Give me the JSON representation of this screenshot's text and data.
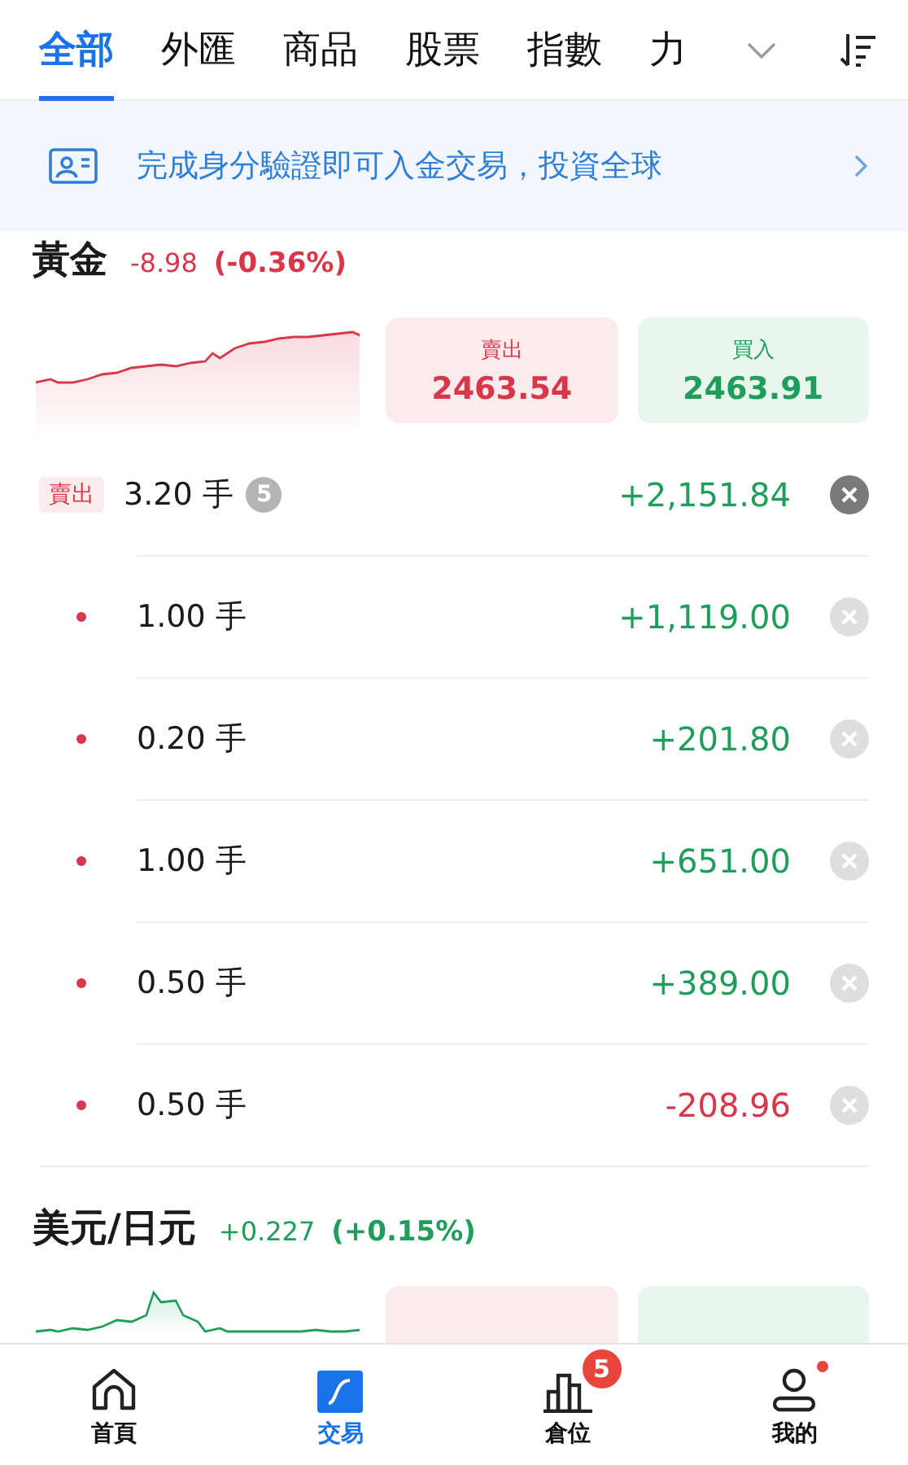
{
  "tabs": [
    {
      "label": "全部",
      "selected": true
    },
    {
      "label": "外匯",
      "selected": false
    },
    {
      "label": "商品",
      "selected": false
    },
    {
      "label": "股票",
      "selected": false
    },
    {
      "label": "指數",
      "selected": false
    },
    {
      "label": "力",
      "selected": false
    }
  ],
  "banner": {
    "text": "完成身分驗證即可入金交易，投資全球"
  },
  "instruments": [
    {
      "name": "黃金",
      "change": "-8.98",
      "change_pct": "(-0.36%)",
      "color": "#d9364a",
      "sell_label": "賣出",
      "sell_price": "2463.54",
      "buy_label": "買入",
      "buy_price": "2463.91",
      "positions": [
        {
          "kind": "group",
          "side": "賣出",
          "lots": "3.20 手",
          "count": "5",
          "pnl": "+2,151.84",
          "color": "#1e9e5a",
          "children": [
            {
              "kind": "item",
              "lots": "1.00 手",
              "pnl": "+1,119.00",
              "color": "#1e9e5a"
            },
            {
              "kind": "item",
              "lots": "0.20 手",
              "pnl": "+201.80",
              "color": "#1e9e5a"
            },
            {
              "kind": "item",
              "lots": "1.00 手",
              "pnl": "+651.00",
              "color": "#1e9e5a"
            },
            {
              "kind": "item",
              "lots": "0.50 手",
              "pnl": "+389.00",
              "color": "#1e9e5a"
            },
            {
              "kind": "item",
              "lots": "0.50 手",
              "pnl": "-208.96",
              "color": "#d9364a"
            }
          ]
        }
      ]
    },
    {
      "name": "美元/日元",
      "change": "+0.227",
      "change_pct": "(+0.15%)",
      "color": "#1e9e5a"
    }
  ],
  "nav": [
    {
      "kind": "home",
      "label": "首頁",
      "selected": false
    },
    {
      "kind": "trade",
      "label": "交易",
      "selected": true
    },
    {
      "kind": "positions",
      "label": "倉位",
      "selected": false,
      "badge": "5"
    },
    {
      "kind": "profile",
      "label": "我的",
      "selected": false,
      "dot": true
    }
  ]
}
